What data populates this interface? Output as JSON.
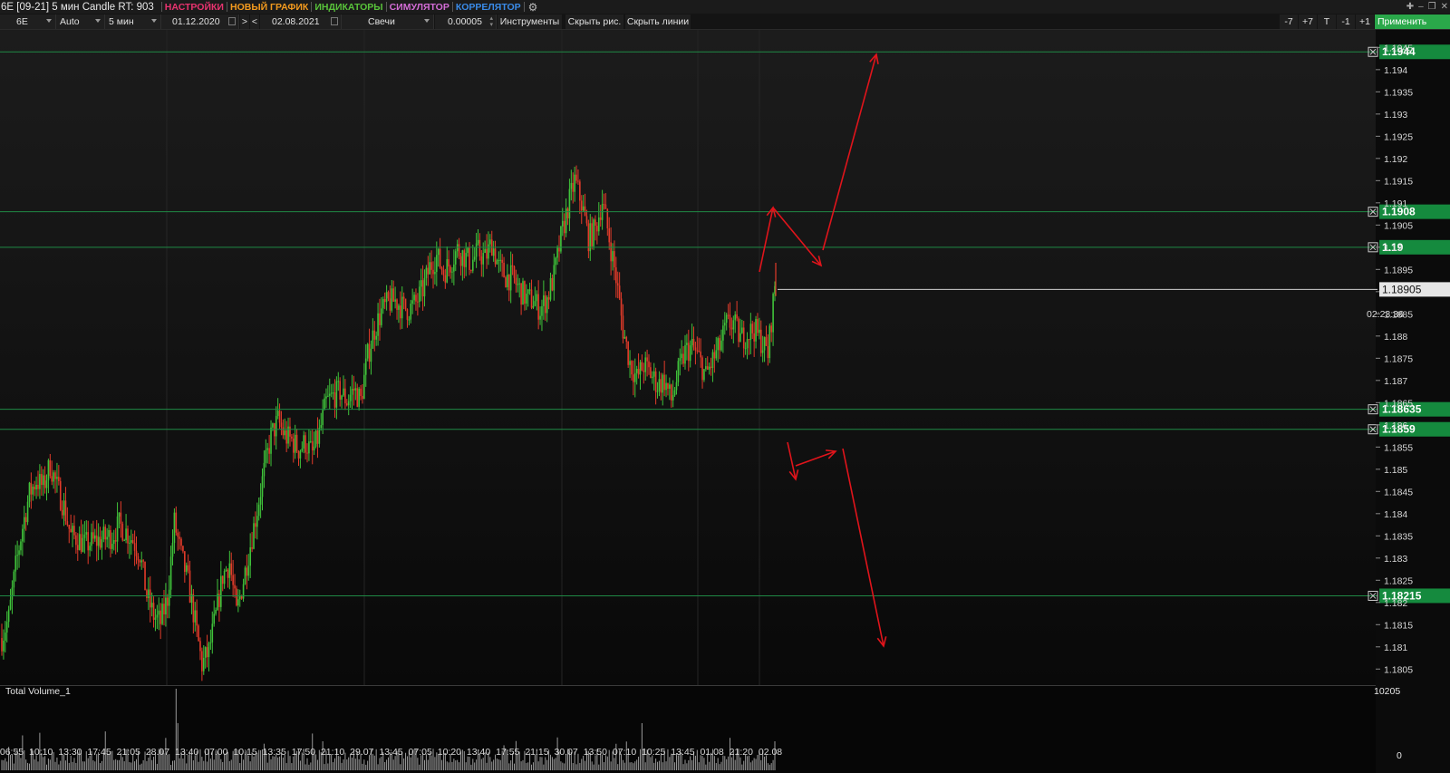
{
  "window": {
    "title": "6E [09-21] 5 мин Candle RT: 903",
    "menus": [
      {
        "label": "НАСТРОЙКИ",
        "color": "#e8336f"
      },
      {
        "label": "НОВЫЙ ГРАФИК",
        "color": "#f39a1e"
      },
      {
        "label": "ИНДИКАТОРЫ",
        "color": "#58c23a"
      },
      {
        "label": "СИМУЛЯТОР",
        "color": "#d36cd6"
      },
      {
        "label": "КОРРЕЛЯТОР",
        "color": "#3a8be8"
      }
    ]
  },
  "toolbar": {
    "symbol": "6E",
    "scale": "Auto",
    "timeframe": "5 мин",
    "date_from": "01.12.2020",
    "nav_next": ">",
    "nav_prev": "<",
    "date_to": "02.08.2021",
    "chart_type": "Свечи",
    "tick_size": "0.00005",
    "instruments": "Инструменты",
    "hide_drawings": "Скрыть рис.",
    "hide_lines": "Скрыть линии",
    "step_buttons": [
      "-7",
      "+7",
      "T",
      "-1",
      "+1"
    ],
    "apply": "Применить"
  },
  "colors": {
    "up": "#3fc23a",
    "down": "#e23b2a",
    "level_line": "#1f8a45",
    "level_label_bg": "#158a3e",
    "arrow": "#e0141b",
    "volume": "#9a9a9a"
  },
  "chart": {
    "price_axis": [
      "1.1945",
      "1.194",
      "1.1935",
      "1.193",
      "1.1925",
      "1.192",
      "1.1915",
      "1.191",
      "1.1905",
      "1.19",
      "1.1895",
      "1.189",
      "1.1885",
      "1.188",
      "1.1875",
      "1.187",
      "1.1865",
      "1.186",
      "1.1855",
      "1.185",
      "1.1845",
      "1.184",
      "1.1835",
      "1.183",
      "1.1825",
      "1.182",
      "1.1815",
      "1.181",
      "1.1805"
    ],
    "price_min": 1.1802,
    "price_max": 1.19465,
    "levels": [
      {
        "price": 1.1944,
        "label": "1.1944"
      },
      {
        "price": 1.1908,
        "label": "1.1908"
      },
      {
        "price": 1.19,
        "label": "1.19"
      },
      {
        "price": 1.18635,
        "label": "1.18635"
      },
      {
        "price": 1.1859,
        "label": "1.1859"
      },
      {
        "price": 1.18215,
        "label": "1.18215"
      }
    ],
    "current_price": {
      "price": 1.18905,
      "label": "1.18905",
      "time_to_close": "02:23:36"
    },
    "time_labels": [
      "06:55",
      "10:10",
      "13:30",
      "17:45",
      "21:05",
      "28.07",
      "13:40",
      "07:00",
      "10:15",
      "13:35",
      "17:50",
      "21:10",
      "29.07",
      "13:45",
      "07:05",
      "10:20",
      "13:40",
      "17:55",
      "21:15",
      "30.07",
      "13:50",
      "07:10",
      "10:25",
      "13:45",
      "01.08",
      "21:20",
      "02.08"
    ],
    "price_path": [
      [
        0,
        1.1812
      ],
      [
        4,
        1.18165
      ],
      [
        8,
        1.1828
      ],
      [
        12,
        1.1837
      ],
      [
        16,
        1.18445
      ],
      [
        20,
        1.18475
      ],
      [
        24,
        1.1846
      ],
      [
        28,
        1.1851
      ],
      [
        32,
        1.1846
      ],
      [
        36,
        1.18415
      ],
      [
        40,
        1.1835
      ],
      [
        44,
        1.18345
      ],
      [
        48,
        1.1833
      ],
      [
        52,
        1.18335
      ],
      [
        56,
        1.1834
      ],
      [
        60,
        1.18345
      ],
      [
        64,
        1.1835
      ],
      [
        68,
        1.18375
      ],
      [
        72,
        1.1836
      ],
      [
        76,
        1.1834
      ],
      [
        80,
        1.1831
      ],
      [
        84,
        1.18215
      ],
      [
        88,
        1.1817
      ],
      [
        92,
        1.18155
      ],
      [
        96,
        1.1821
      ],
      [
        100,
        1.1838
      ],
      [
        104,
        1.18305
      ],
      [
        108,
        1.18245
      ],
      [
        112,
        1.18155
      ],
      [
        116,
        1.1806
      ],
      [
        120,
        1.1809
      ],
      [
        124,
        1.1817
      ],
      [
        128,
        1.1826
      ],
      [
        132,
        1.1829
      ],
      [
        136,
        1.18175
      ],
      [
        140,
        1.1825
      ],
      [
        144,
        1.1833
      ],
      [
        148,
        1.1841
      ],
      [
        152,
        1.18495
      ],
      [
        156,
        1.18575
      ],
      [
        160,
        1.1861
      ],
      [
        164,
        1.18575
      ],
      [
        168,
        1.18565
      ],
      [
        172,
        1.18545
      ],
      [
        176,
        1.1856
      ],
      [
        180,
        1.18535
      ],
      [
        184,
        1.1858
      ],
      [
        188,
        1.1865
      ],
      [
        192,
        1.18665
      ],
      [
        196,
        1.18675
      ],
      [
        200,
        1.18655
      ],
      [
        204,
        1.1868
      ],
      [
        208,
        1.18655
      ],
      [
        212,
        1.18755
      ],
      [
        216,
        1.18815
      ],
      [
        220,
        1.18855
      ],
      [
        224,
        1.18875
      ],
      [
        228,
        1.1888
      ],
      [
        232,
        1.18865
      ],
      [
        236,
        1.1886
      ],
      [
        240,
        1.18875
      ],
      [
        244,
        1.18905
      ],
      [
        248,
        1.18955
      ],
      [
        252,
        1.1898
      ],
      [
        256,
        1.18945
      ],
      [
        260,
        1.18965
      ],
      [
        264,
        1.18995
      ],
      [
        268,
        1.1898
      ],
      [
        272,
        1.18965
      ],
      [
        276,
        1.1899
      ],
      [
        280,
        1.18975
      ],
      [
        284,
        1.1901
      ],
      [
        288,
        1.18955
      ],
      [
        292,
        1.18935
      ],
      [
        296,
        1.1893
      ],
      [
        300,
        1.18905
      ],
      [
        304,
        1.18885
      ],
      [
        308,
        1.1888
      ],
      [
        312,
        1.1886
      ],
      [
        316,
        1.18885
      ],
      [
        320,
        1.18935
      ],
      [
        324,
        1.1902
      ],
      [
        328,
        1.1909
      ],
      [
        332,
        1.1915
      ],
      [
        336,
        1.191
      ],
      [
        340,
        1.1902
      ],
      [
        344,
        1.1904
      ],
      [
        348,
        1.19105
      ],
      [
        352,
        1.1902
      ],
      [
        356,
        1.1893
      ],
      [
        360,
        1.18815
      ],
      [
        364,
        1.1874
      ],
      [
        368,
        1.18705
      ],
      [
        372,
        1.18735
      ],
      [
        376,
        1.18715
      ],
      [
        380,
        1.1869
      ],
      [
        384,
        1.187
      ],
      [
        388,
        1.18655
      ],
      [
        392,
        1.18715
      ],
      [
        396,
        1.18765
      ],
      [
        400,
        1.18775
      ],
      [
        404,
        1.1875
      ],
      [
        408,
        1.1871
      ],
      [
        412,
        1.18745
      ],
      [
        416,
        1.18775
      ],
      [
        420,
        1.18825
      ],
      [
        424,
        1.1883
      ],
      [
        428,
        1.18795
      ],
      [
        432,
        1.18805
      ],
      [
        436,
        1.18815
      ],
      [
        440,
        1.1879
      ],
      [
        444,
        1.1876
      ],
      [
        448,
        1.18915
      ]
    ],
    "vol_label": "Total Volume_1",
    "vol_max_label": "10205",
    "vol_zero_label": "0"
  }
}
